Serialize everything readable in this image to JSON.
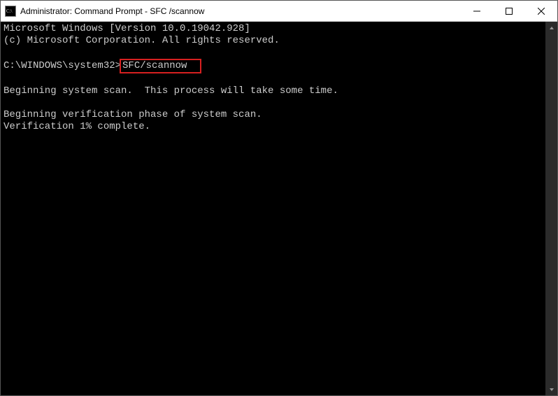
{
  "titlebar": {
    "icon_text": "C:\\",
    "title": "Administrator: Command Prompt - SFC /scannow"
  },
  "terminal": {
    "line1": "Microsoft Windows [Version 10.0.19042.928]",
    "line2": "(c) Microsoft Corporation. All rights reserved.",
    "blank1": "",
    "prompt_path": "C:\\WINDOWS\\system32>",
    "command": "SFC/scannow",
    "blank2": "",
    "scan_msg": "Beginning system scan.  This process will take some time.",
    "blank3": "",
    "verify_msg": "Beginning verification phase of system scan.",
    "progress_msg": "Verification 1% complete."
  }
}
